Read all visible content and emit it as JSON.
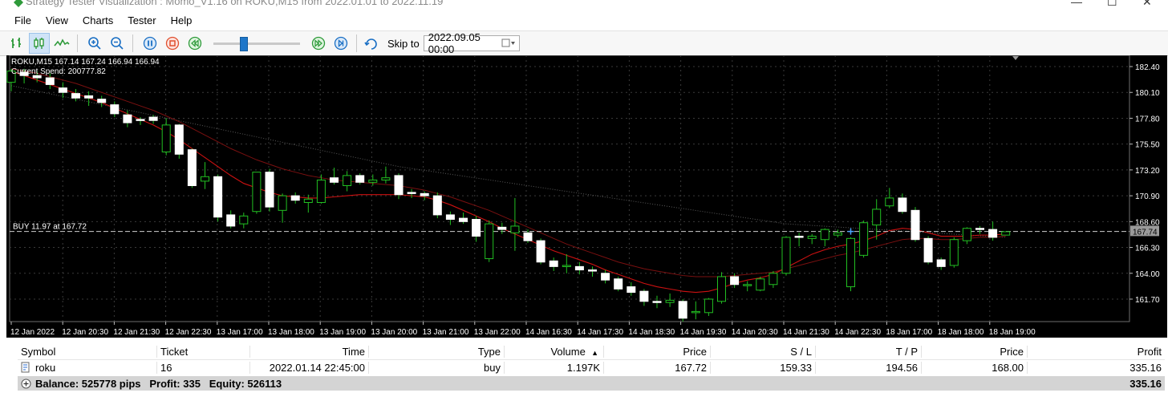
{
  "window": {
    "title": "Strategy Tester Visualization : Momo_V1.16 on ROKU,M15 from 2022.01.01 to 2022.11.19"
  },
  "menu": [
    "File",
    "View",
    "Charts",
    "Tester",
    "Help"
  ],
  "toolbar": {
    "skip_label": "Skip to",
    "skip_value": "2022.09.05 00:00",
    "slider_position": 0.33
  },
  "chart": {
    "info_line": "ROKU,M15  167.14 167.24 166.94 166.94",
    "spend_line": "Current Spend: 200777.82",
    "trade_label": "BUY 11.97 at 167.72",
    "current_price": "167.74",
    "colors": {
      "background": "#000000",
      "bull_body": "#000000",
      "bear_body": "#ffffff",
      "wick": "#22c022",
      "ma_fast": "#cc1111",
      "ma_slow": "#7a1010",
      "long_trend": "#5a5a5a"
    }
  },
  "chart_data": {
    "type": "candlestick",
    "symbol": "ROKU",
    "timeframe": "M15",
    "y_ticks": [
      182.4,
      180.1,
      177.8,
      175.5,
      173.2,
      170.9,
      168.6,
      166.3,
      164.0,
      161.7
    ],
    "ylim": [
      159.7,
      183.4
    ],
    "x_ticks": [
      "12 Jan 2022",
      "12 Jan 20:30",
      "12 Jan 21:30",
      "12 Jan 22:30",
      "13 Jan 17:00",
      "13 Jan 18:00",
      "13 Jan 19:00",
      "13 Jan 20:00",
      "13 Jan 21:00",
      "13 Jan 22:00",
      "14 Jan 16:30",
      "14 Jan 17:30",
      "14 Jan 18:30",
      "14 Jan 19:30",
      "14 Jan 20:30",
      "14 Jan 21:30",
      "14 Jan 22:30",
      "18 Jan 17:00",
      "18 Jan 18:00",
      "18 Jan 19:00"
    ],
    "trade_level": 167.72,
    "current_price": 167.74,
    "candles": [
      {
        "o": 181.0,
        "h": 182.2,
        "c": 182.0,
        "l": 180.2
      },
      {
        "o": 181.9,
        "h": 182.2,
        "c": 181.6,
        "l": 180.9
      },
      {
        "o": 181.6,
        "h": 182.0,
        "c": 181.4,
        "l": 181.0
      },
      {
        "o": 181.4,
        "h": 181.8,
        "c": 180.8,
        "l": 180.4
      },
      {
        "o": 180.5,
        "h": 181.0,
        "c": 180.1,
        "l": 179.6
      },
      {
        "o": 180.0,
        "h": 180.4,
        "c": 179.6,
        "l": 179.3
      },
      {
        "o": 179.8,
        "h": 180.2,
        "c": 179.6,
        "l": 178.9
      },
      {
        "o": 179.5,
        "h": 179.8,
        "c": 179.2,
        "l": 178.8
      },
      {
        "o": 179.0,
        "h": 179.3,
        "c": 178.2,
        "l": 177.9
      },
      {
        "o": 178.1,
        "h": 178.5,
        "c": 177.4,
        "l": 177.0
      },
      {
        "o": 177.7,
        "h": 177.9,
        "c": 177.6,
        "l": 177.2
      },
      {
        "o": 177.9,
        "h": 178.1,
        "c": 177.6,
        "l": 177.3
      },
      {
        "o": 174.8,
        "h": 177.8,
        "c": 177.2,
        "l": 174.5
      },
      {
        "o": 177.2,
        "h": 177.3,
        "c": 174.6,
        "l": 174.2
      },
      {
        "o": 175.0,
        "h": 175.1,
        "c": 171.8,
        "l": 171.6
      },
      {
        "o": 172.2,
        "h": 173.9,
        "c": 172.6,
        "l": 171.5
      },
      {
        "o": 172.6,
        "h": 172.8,
        "c": 169.0,
        "l": 168.6
      },
      {
        "o": 169.2,
        "h": 169.6,
        "c": 168.2,
        "l": 168.0
      },
      {
        "o": 168.4,
        "h": 169.4,
        "c": 169.1,
        "l": 168.0
      },
      {
        "o": 169.5,
        "h": 173.0,
        "c": 173.0,
        "l": 169.3
      },
      {
        "o": 173.0,
        "h": 173.3,
        "c": 169.9,
        "l": 169.5
      },
      {
        "o": 169.6,
        "h": 171.1,
        "c": 170.9,
        "l": 168.5
      },
      {
        "o": 170.9,
        "h": 171.2,
        "c": 170.5,
        "l": 170.2
      },
      {
        "o": 170.3,
        "h": 171.0,
        "c": 170.6,
        "l": 169.4
      },
      {
        "o": 170.3,
        "h": 172.8,
        "c": 172.3,
        "l": 170.2
      },
      {
        "o": 172.5,
        "h": 173.4,
        "c": 172.1,
        "l": 171.9
      },
      {
        "o": 171.8,
        "h": 173.1,
        "c": 172.7,
        "l": 171.3
      },
      {
        "o": 172.7,
        "h": 172.9,
        "c": 172.1,
        "l": 171.9
      },
      {
        "o": 172.1,
        "h": 172.8,
        "c": 172.3,
        "l": 171.8
      },
      {
        "o": 172.3,
        "h": 173.5,
        "c": 172.5,
        "l": 172.0
      },
      {
        "o": 172.7,
        "h": 172.9,
        "c": 171.0,
        "l": 170.6
      },
      {
        "o": 171.2,
        "h": 171.5,
        "c": 171.1,
        "l": 170.7
      },
      {
        "o": 171.1,
        "h": 171.3,
        "c": 170.9,
        "l": 170.5
      },
      {
        "o": 170.9,
        "h": 171.2,
        "c": 169.2,
        "l": 168.9
      },
      {
        "o": 169.2,
        "h": 169.5,
        "c": 168.8,
        "l": 168.3
      },
      {
        "o": 168.9,
        "h": 169.4,
        "c": 168.6,
        "l": 168.4
      },
      {
        "o": 168.8,
        "h": 169.1,
        "c": 167.3,
        "l": 166.8
      },
      {
        "o": 165.3,
        "h": 168.7,
        "c": 168.4,
        "l": 165.0
      },
      {
        "o": 168.1,
        "h": 168.5,
        "c": 167.9,
        "l": 167.5
      },
      {
        "o": 167.6,
        "h": 170.7,
        "c": 168.2,
        "l": 166.0
      },
      {
        "o": 167.6,
        "h": 167.9,
        "c": 166.9,
        "l": 166.7
      },
      {
        "o": 166.9,
        "h": 167.1,
        "c": 165.0,
        "l": 164.8
      },
      {
        "o": 165.1,
        "h": 165.4,
        "c": 164.6,
        "l": 164.2
      },
      {
        "o": 164.6,
        "h": 165.7,
        "c": 164.7,
        "l": 164.0
      },
      {
        "o": 164.6,
        "h": 165.0,
        "c": 164.3,
        "l": 163.9
      },
      {
        "o": 164.3,
        "h": 164.6,
        "c": 164.2,
        "l": 163.7
      },
      {
        "o": 164.0,
        "h": 164.3,
        "c": 163.4,
        "l": 163.1
      },
      {
        "o": 163.5,
        "h": 163.7,
        "c": 162.6,
        "l": 162.4
      },
      {
        "o": 162.8,
        "h": 163.2,
        "c": 162.3,
        "l": 162.0
      },
      {
        "o": 162.4,
        "h": 162.6,
        "c": 161.5,
        "l": 161.1
      },
      {
        "o": 161.5,
        "h": 162.0,
        "c": 161.4,
        "l": 160.9
      },
      {
        "o": 161.4,
        "h": 162.2,
        "c": 161.6,
        "l": 161.0
      },
      {
        "o": 161.5,
        "h": 161.7,
        "c": 160.0,
        "l": 159.7
      },
      {
        "o": 160.5,
        "h": 161.5,
        "c": 160.6,
        "l": 159.9
      },
      {
        "o": 160.5,
        "h": 161.8,
        "c": 161.7,
        "l": 160.2
      },
      {
        "o": 161.5,
        "h": 164.1,
        "c": 163.7,
        "l": 161.3
      },
      {
        "o": 163.7,
        "h": 164.0,
        "c": 163.0,
        "l": 162.7
      },
      {
        "o": 162.9,
        "h": 163.3,
        "c": 163.0,
        "l": 162.4
      },
      {
        "o": 162.5,
        "h": 163.7,
        "c": 163.5,
        "l": 162.4
      },
      {
        "o": 163.0,
        "h": 164.2,
        "c": 164.0,
        "l": 162.7
      },
      {
        "o": 164.0,
        "h": 167.3,
        "c": 167.2,
        "l": 163.8
      },
      {
        "o": 167.3,
        "h": 167.6,
        "c": 167.2,
        "l": 166.4
      },
      {
        "o": 167.1,
        "h": 167.5,
        "c": 167.3,
        "l": 166.6
      },
      {
        "o": 167.0,
        "h": 168.0,
        "c": 167.9,
        "l": 166.4
      },
      {
        "o": 167.4,
        "h": 167.9,
        "c": 167.6,
        "l": 167.2
      },
      {
        "o": 162.8,
        "h": 167.2,
        "c": 167.1,
        "l": 162.4
      },
      {
        "o": 165.6,
        "h": 168.7,
        "c": 168.5,
        "l": 165.4
      },
      {
        "o": 168.3,
        "h": 170.6,
        "c": 169.7,
        "l": 167.0
      },
      {
        "o": 170.0,
        "h": 171.6,
        "c": 170.7,
        "l": 169.8
      },
      {
        "o": 170.7,
        "h": 171.1,
        "c": 169.5,
        "l": 169.3
      },
      {
        "o": 169.6,
        "h": 169.9,
        "c": 167.0,
        "l": 166.8
      },
      {
        "o": 167.1,
        "h": 167.3,
        "c": 165.0,
        "l": 164.8
      },
      {
        "o": 165.2,
        "h": 165.4,
        "c": 164.6,
        "l": 164.3
      },
      {
        "o": 164.7,
        "h": 167.2,
        "c": 167.0,
        "l": 164.5
      },
      {
        "o": 166.9,
        "h": 168.1,
        "c": 168.0,
        "l": 166.6
      },
      {
        "o": 168.0,
        "h": 168.2,
        "c": 167.9,
        "l": 167.5
      },
      {
        "o": 167.9,
        "h": 168.6,
        "c": 167.2,
        "l": 166.9
      },
      {
        "o": 167.4,
        "h": 167.7,
        "c": 167.7,
        "l": 167.4
      }
    ],
    "ma_fast": [
      182.0,
      181.6,
      181.2,
      180.8,
      180.4,
      180.0,
      179.6,
      179.2,
      178.7,
      178.2,
      177.7,
      177.2,
      176.6,
      175.9,
      175.1,
      174.3,
      173.5,
      172.7,
      172.0,
      171.6,
      171.2,
      170.9,
      170.8,
      170.7,
      170.7,
      170.8,
      170.9,
      171.0,
      171.0,
      171.0,
      171.0,
      170.9,
      170.8,
      170.5,
      170.1,
      169.6,
      169.1,
      168.6,
      168.0,
      167.5,
      167.0,
      166.5,
      166.0,
      165.6,
      165.2,
      164.8,
      164.3,
      163.9,
      163.5,
      163.1,
      162.8,
      162.6,
      162.4,
      162.3,
      162.4,
      162.7,
      163.1,
      163.4,
      163.6,
      163.9,
      164.5,
      165.1,
      165.7,
      166.1,
      166.4,
      166.6,
      166.9,
      167.3,
      167.8,
      168.0,
      167.9,
      167.6,
      167.3,
      167.3,
      167.3,
      167.4,
      167.4,
      167.5
    ],
    "ma_slow": [
      182.2,
      182.0,
      181.8,
      181.5,
      181.2,
      180.9,
      180.5,
      180.1,
      179.7,
      179.3,
      178.9,
      178.5,
      178.0,
      177.5,
      176.9,
      176.3,
      175.7,
      175.1,
      174.6,
      174.1,
      173.7,
      173.3,
      173.0,
      172.7,
      172.5,
      172.3,
      172.2,
      172.1,
      172.0,
      171.9,
      171.8,
      171.6,
      171.4,
      171.1,
      170.8,
      170.4,
      170.0,
      169.6,
      169.1,
      168.6,
      168.1,
      167.6,
      167.1,
      166.6,
      166.2,
      165.8,
      165.4,
      165.0,
      164.7,
      164.4,
      164.2,
      164.0,
      163.8,
      163.7,
      163.7,
      163.7,
      163.8,
      163.9,
      164.0,
      164.1,
      164.4,
      164.7,
      165.0,
      165.3,
      165.6,
      165.8,
      166.1,
      166.4,
      166.7,
      167.0,
      167.1,
      167.1,
      167.0,
      167.0,
      167.1,
      167.2,
      167.2,
      167.3
    ],
    "long_trend": [
      {
        "i": 0,
        "v": 180.7
      },
      {
        "i": 30,
        "v": 173.5
      },
      {
        "i": 60,
        "v": 168.4
      },
      {
        "i": 77,
        "v": 167.2
      }
    ]
  },
  "table": {
    "headers": [
      "Symbol",
      "Ticket",
      "Time",
      "Type",
      "Volume",
      "Price",
      "S / L",
      "T / P",
      "Price",
      "Profit"
    ],
    "sort_indicator": "▲",
    "rows": [
      {
        "symbol": "roku",
        "ticket": "16",
        "time": "2022.01.14 22:45:00",
        "type": "buy",
        "volume": "1.197K",
        "price": "167.72",
        "sl": "159.33",
        "tp": "194.56",
        "cur_price": "168.00",
        "profit": "335.16"
      }
    ],
    "summary": "Balance: 525778 pips   Profit: 335   Equity: 526113",
    "summary_profit": "335.16"
  }
}
